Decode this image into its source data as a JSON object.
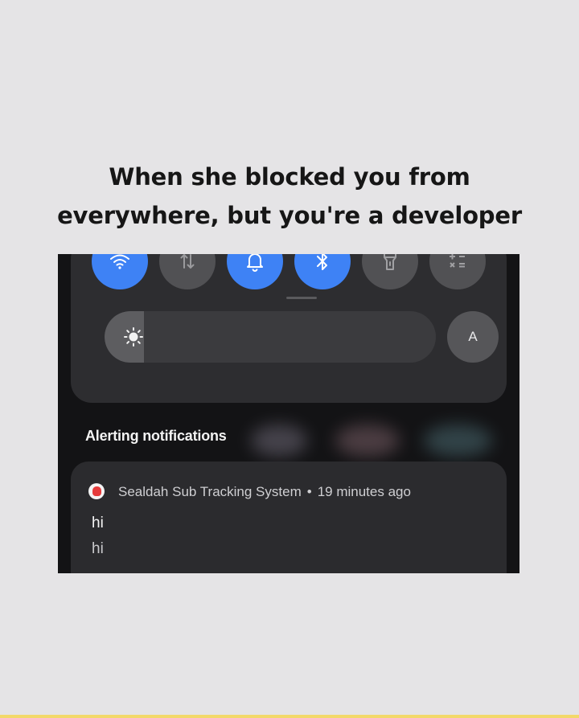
{
  "caption": {
    "line1": "When she blocked you from",
    "line2": "everywhere, but you're a developer"
  },
  "quick_settings": {
    "tiles": [
      {
        "icon": "wifi-icon",
        "active": true
      },
      {
        "icon": "mobile-data-icon",
        "active": false
      },
      {
        "icon": "bell-icon",
        "active": true
      },
      {
        "icon": "bluetooth-icon",
        "active": true
      },
      {
        "icon": "flashlight-icon",
        "active": false
      },
      {
        "icon": "calculator-icon",
        "active": false
      }
    ],
    "brightness_level": 0.12,
    "auto_brightness_label": "A",
    "accent_color": "#3e82f5"
  },
  "notifications": {
    "section_title": "Alerting notifications",
    "items": [
      {
        "app_name": "Sealdah Sub Tracking System",
        "separator": "•",
        "time": "19 minutes ago",
        "title": "hi",
        "body": "hi"
      }
    ]
  }
}
